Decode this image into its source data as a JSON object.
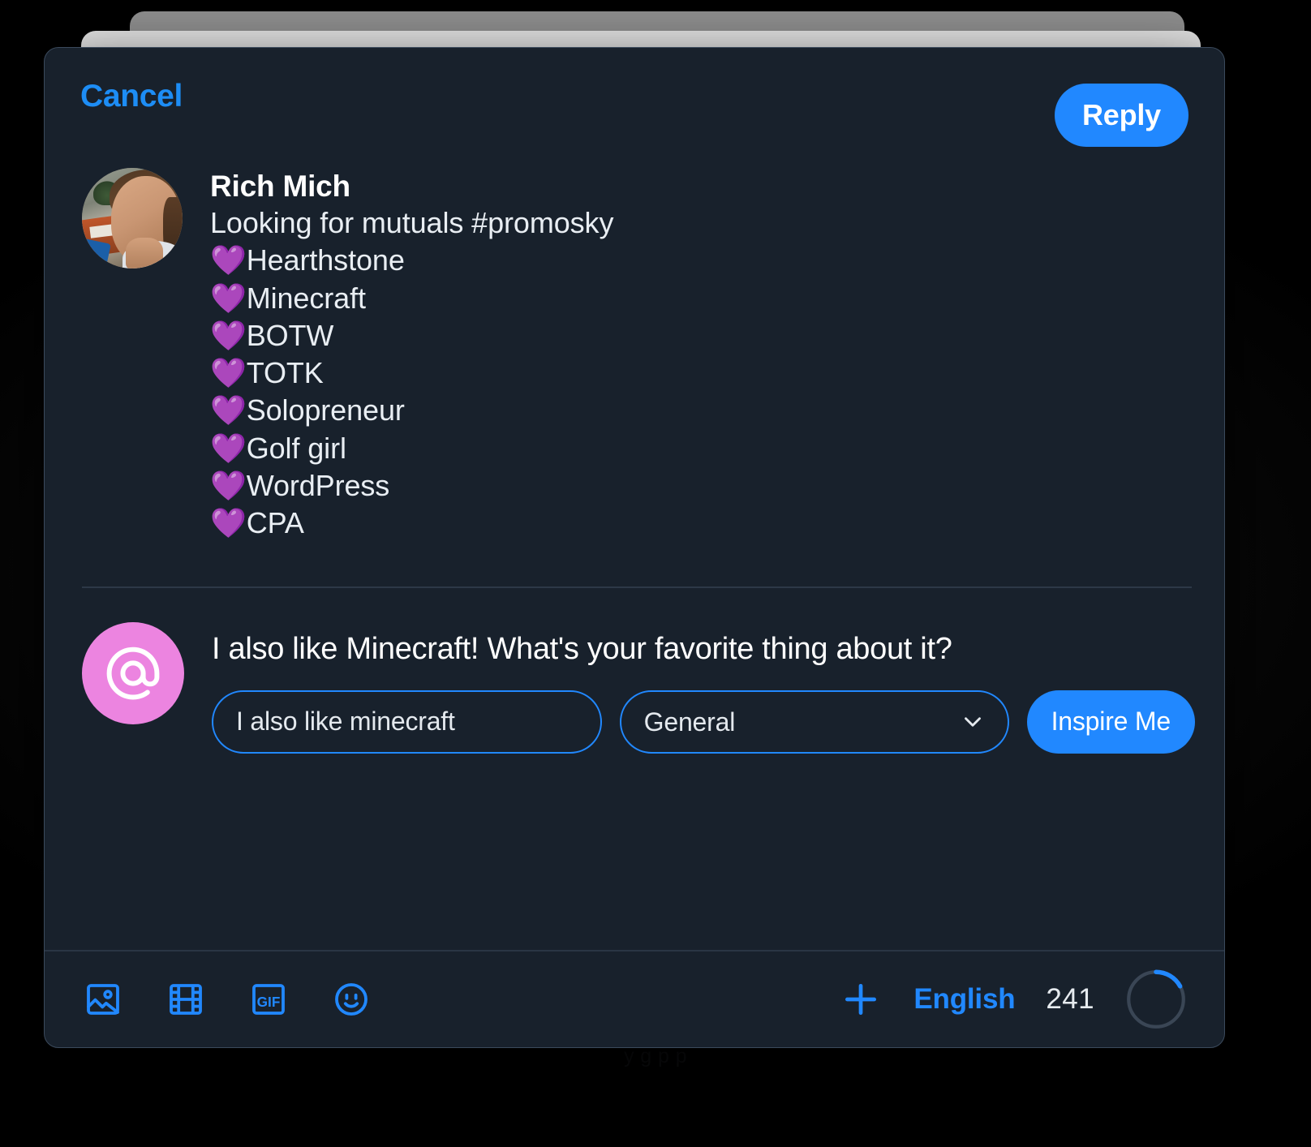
{
  "header": {
    "cancel_label": "Cancel",
    "reply_label": "Reply"
  },
  "quoted_post": {
    "author_name": "Rich Mich",
    "avatar": "user-photo-avatar",
    "lines": [
      "Looking for mutuals #promosky",
      "💜Hearthstone",
      "💜Minecraft",
      "💜BOTW",
      "💜TOTK",
      "💜Solopreneur",
      "💜Golf girl",
      "💜WordPress",
      "💜CPA"
    ]
  },
  "composer": {
    "avatar_icon": "at-symbol-avatar",
    "reply_text": "I also like Minecraft! What's your favorite thing about it?",
    "prompt_input": {
      "value": "I also like minecraft",
      "placeholder": "I also like minecraft"
    },
    "tone_select": {
      "selected": "General",
      "options": [
        "General"
      ],
      "chevron": "chevron-down-icon"
    },
    "inspire_label": "Inspire Me"
  },
  "toolbar": {
    "icons": [
      {
        "name": "image-icon",
        "label": "Image"
      },
      {
        "name": "video-icon",
        "label": "Video"
      },
      {
        "name": "gif-icon",
        "label": "GIF"
      },
      {
        "name": "emoji-icon",
        "label": "Emoji"
      }
    ],
    "gif_label": "GIF",
    "add_icon": "plus-icon",
    "language_label": "English",
    "char_count": "241",
    "progress_percent": 17
  },
  "background": {
    "ghost_text": "y g p p"
  },
  "colors": {
    "accent_blue": "#2188ff",
    "link_blue": "#1d8df5",
    "modal_bg": "#18212c",
    "avatar_pink": "#ec84e0",
    "heart_purple": "#a855f7",
    "text_white": "#ffffff",
    "divider": "#42506180"
  }
}
